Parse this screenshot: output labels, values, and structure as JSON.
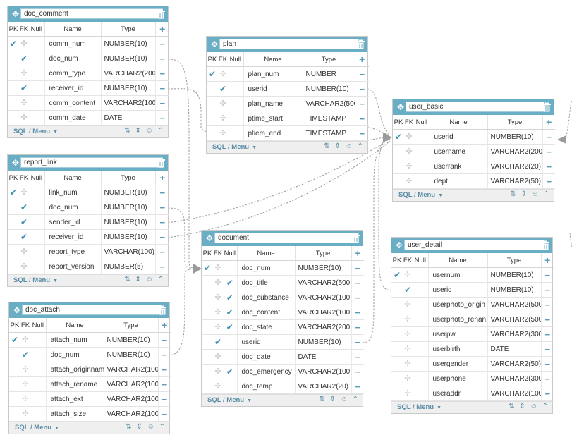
{
  "ui": {
    "col_pk": "PK",
    "col_fk": "FK",
    "col_null": "Null",
    "col_name": "Name",
    "col_type": "Type",
    "footer_menu": "SQL / Menu"
  },
  "colors": {
    "header": "#6aaec6",
    "check": "#3d8fb0",
    "link": "#999999"
  },
  "tables": [
    {
      "id": "doc_comment",
      "name": "doc_comment",
      "rows": [
        {
          "name": "comm_num",
          "type": "NUMBER(10)",
          "pk": true,
          "fk": false
        },
        {
          "name": "doc_num",
          "type": "NUMBER(10)",
          "pk": false,
          "fk": true
        },
        {
          "name": "comm_type",
          "type": "VARCHAR2(200",
          "pk": false,
          "fk": false
        },
        {
          "name": "receiver_id",
          "type": "NUMBER(10)",
          "pk": false,
          "fk": true
        },
        {
          "name": "comm_content",
          "type": "VARCHAR2(100",
          "pk": false,
          "fk": false
        },
        {
          "name": "comm_date",
          "type": "DATE",
          "pk": false,
          "fk": false
        }
      ]
    },
    {
      "id": "report_link",
      "name": "report_link",
      "rows": [
        {
          "name": "link_num",
          "type": "NUMBER(10)",
          "pk": true,
          "fk": false
        },
        {
          "name": "doc_num",
          "type": "NUMBER(10)",
          "pk": false,
          "fk": true
        },
        {
          "name": "sender_id",
          "type": "NUMBER(10)",
          "pk": false,
          "fk": true
        },
        {
          "name": "receiver_id",
          "type": "NUMBER(10)",
          "pk": false,
          "fk": true
        },
        {
          "name": "report_type",
          "type": "VARCHAR(100)",
          "pk": false,
          "fk": false
        },
        {
          "name": "report_version",
          "type": "NUMBER(5)",
          "pk": false,
          "fk": false
        }
      ]
    },
    {
      "id": "doc_attach",
      "name": "doc_attach",
      "rows": [
        {
          "name": "attach_num",
          "type": "NUMBER(10)",
          "pk": true,
          "fk": false
        },
        {
          "name": "doc_num",
          "type": "NUMBER(10)",
          "pk": false,
          "fk": true
        },
        {
          "name": "attach_originnam",
          "type": "VARCHAR2(100",
          "pk": false,
          "fk": false
        },
        {
          "name": "attach_rename",
          "type": "VARCHAR2(100",
          "pk": false,
          "fk": false
        },
        {
          "name": "attach_ext",
          "type": "VARCHAR2(100",
          "pk": false,
          "fk": false
        },
        {
          "name": "attach_size",
          "type": "VARCHAR2(100",
          "pk": false,
          "fk": false
        }
      ]
    },
    {
      "id": "plan",
      "name": "plan",
      "rows": [
        {
          "name": "plan_num",
          "type": "NUMBER",
          "pk": true,
          "fk": false
        },
        {
          "name": "userid",
          "type": "NUMBER(10)",
          "pk": false,
          "fk": true
        },
        {
          "name": "plan_name",
          "type": "VARCHAR2(500",
          "pk": false,
          "fk": false
        },
        {
          "name": "ptime_start",
          "type": "TIMESTAMP",
          "pk": false,
          "fk": false
        },
        {
          "name": "ptiem_end",
          "type": "TIMESTAMP",
          "pk": false,
          "fk": false
        }
      ]
    },
    {
      "id": "document",
      "name": "document",
      "rows": [
        {
          "name": "doc_num",
          "type": "NUMBER(10)",
          "pk": true,
          "fk": false,
          "nn": false
        },
        {
          "name": "doc_title",
          "type": "VARCHAR2(500",
          "pk": false,
          "fk": false,
          "nn": true
        },
        {
          "name": "doc_substance",
          "type": "VARCHAR2(100",
          "pk": false,
          "fk": false,
          "nn": true
        },
        {
          "name": "doc_content",
          "type": "VARCHAR2(100",
          "pk": false,
          "fk": false,
          "nn": true
        },
        {
          "name": "doc_state",
          "type": "VARCHAR2(200",
          "pk": false,
          "fk": false,
          "nn": true
        },
        {
          "name": "userid",
          "type": "NUMBER(10)",
          "pk": false,
          "fk": true,
          "nn": false
        },
        {
          "name": "doc_date",
          "type": "DATE",
          "pk": false,
          "fk": false,
          "nn": false
        },
        {
          "name": "doc_emergency",
          "type": "VARCHAR2(100",
          "pk": false,
          "fk": false,
          "nn": true
        },
        {
          "name": "doc_temp",
          "type": "VARCHAR2(20)",
          "pk": false,
          "fk": false,
          "nn": false
        }
      ]
    },
    {
      "id": "user_basic",
      "name": "user_basic",
      "rows": [
        {
          "name": "userid",
          "type": "NUMBER(10)",
          "pk": true,
          "fk": false
        },
        {
          "name": "username",
          "type": "VARCHAR2(200",
          "pk": false,
          "fk": false
        },
        {
          "name": "userrank",
          "type": "VARCHAR2(20)",
          "pk": false,
          "fk": false
        },
        {
          "name": "dept",
          "type": "VARCHAR2(50)",
          "pk": false,
          "fk": false
        }
      ]
    },
    {
      "id": "user_detail",
      "name": "user_detail",
      "rows": [
        {
          "name": "usernum",
          "type": "NUMBER(10)",
          "pk": true,
          "fk": false
        },
        {
          "name": "userid",
          "type": "NUMBER(10)",
          "pk": false,
          "fk": true
        },
        {
          "name": "userphoto_origin",
          "type": "VARCHAR2(500",
          "pk": false,
          "fk": false
        },
        {
          "name": "userphoto_renan",
          "type": "VARCHAR2(500",
          "pk": false,
          "fk": false
        },
        {
          "name": "userpw",
          "type": "VARCHAR2(300",
          "pk": false,
          "fk": false
        },
        {
          "name": "userbirth",
          "type": "DATE",
          "pk": false,
          "fk": false
        },
        {
          "name": "usergender",
          "type": "VARCHAR2(50)",
          "pk": false,
          "fk": false
        },
        {
          "name": "userphone",
          "type": "VARCHAR2(300",
          "pk": false,
          "fk": false
        },
        {
          "name": "useraddr",
          "type": "VARCHAR2(100",
          "pk": false,
          "fk": false
        }
      ]
    }
  ]
}
